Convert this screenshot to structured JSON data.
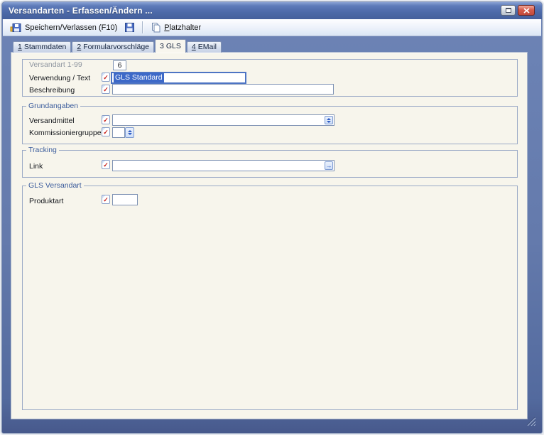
{
  "window": {
    "title": "Versandarten - Erfassen/Ändern ..."
  },
  "toolbar": {
    "save_exit": "Speichern/Verlassen (F10)",
    "platzhalter_accel": "P",
    "platzhalter_rest": "latzhalter"
  },
  "tabs": [
    {
      "num": "1",
      "label": "Stammdaten",
      "active": false
    },
    {
      "num": "2",
      "label": "Formularvorschläge",
      "active": false
    },
    {
      "num": "3",
      "label": "GLS",
      "active": true
    },
    {
      "num": "4",
      "label": "EMail",
      "active": false
    }
  ],
  "form": {
    "versandart": {
      "label": "Versandart 1-99",
      "value": "6"
    },
    "verwendung": {
      "label": "Verwendung / Text",
      "value": "GLS Standard",
      "selected": true
    },
    "beschreibung": {
      "label": "Beschreibung",
      "value": ""
    },
    "grundangaben": {
      "legend": "Grundangaben",
      "versandmittel": {
        "label": "Versandmittel",
        "value": ""
      },
      "kommissioniergruppe": {
        "label": "Kommissioniergruppe",
        "value": ""
      }
    },
    "tracking": {
      "legend": "Tracking",
      "link": {
        "label": "Link",
        "value": ""
      }
    },
    "gls_versandart": {
      "legend": "GLS Versandart",
      "produktart": {
        "label": "Produktart",
        "value": ""
      }
    }
  },
  "icons": {
    "required_check": "✓",
    "link_open": "→"
  },
  "colors": {
    "titlebar_blue": "#4c69a8",
    "frame_steel_blue": "#647aac",
    "panel_cream": "#f7f5ec",
    "selection_blue": "#3d69c8",
    "legend_blue": "#3b5c9c",
    "close_red": "#c04a3c",
    "check_red": "#c8201a"
  }
}
